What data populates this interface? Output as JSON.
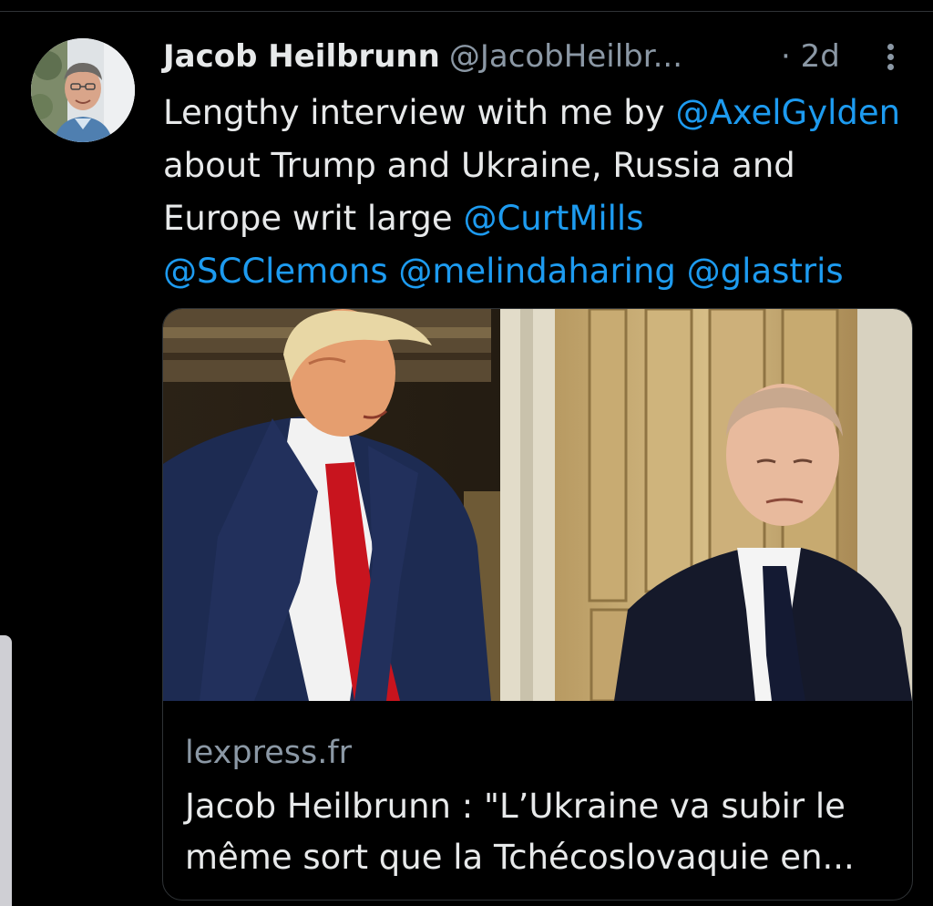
{
  "tweet": {
    "author_name": "Jacob Heilbrunn",
    "author_handle": "@JacobHeilbr...",
    "timestamp": "· 2d",
    "text_parts": [
      {
        "text": "Lengthy interview with me by "
      },
      {
        "text": "@AxelGylden",
        "mention": true
      },
      {
        "text": " about Trump and Ukraine, Russia and Europe writ large "
      },
      {
        "text": "@CurtMills",
        "mention": true
      },
      {
        "text": " "
      },
      {
        "text": "@SCClemons",
        "mention": true
      },
      {
        "text": " "
      },
      {
        "text": "@melindaharing",
        "mention": true
      },
      {
        "text": " "
      },
      {
        "text": "@glastris",
        "mention": true
      }
    ]
  },
  "card": {
    "domain": "lexpress.fr",
    "title": "Jacob Heilbrunn : \"L’Ukraine va subir le même sort que la Tchécoslovaquie en..."
  },
  "icons": {
    "more": "more-vertical-icon"
  },
  "colors": {
    "background": "#000000",
    "text": "#e7e9ea",
    "secondary": "#8b98a5",
    "link": "#1d9bf0"
  }
}
